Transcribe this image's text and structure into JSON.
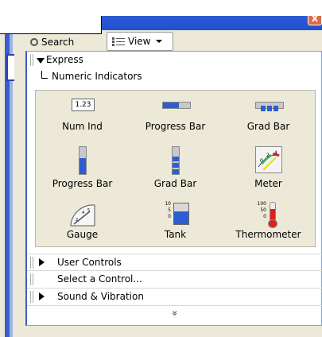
{
  "toolbar": {
    "search_label": "Search",
    "view_label": "View"
  },
  "titlebar": {
    "close_label": "x"
  },
  "tree": {
    "express_label": "Express",
    "numeric_indicators_label": "Numeric Indicators",
    "user_controls_label": "User Controls",
    "select_control_label": "Select a Control...",
    "sound_vibration_label": "Sound & Vibration",
    "more_label": "»"
  },
  "palette": {
    "items": [
      {
        "label": "Num Ind",
        "icon": "num-ind-icon",
        "value_text": "1.23"
      },
      {
        "label": "Progress Bar",
        "icon": "progress-bar-icon"
      },
      {
        "label": "Grad Bar",
        "icon": "grad-bar-icon"
      },
      {
        "label": "Progress Bar",
        "icon": "vertical-progress-bar-icon"
      },
      {
        "label": "Grad Bar",
        "icon": "vertical-grad-bar-icon"
      },
      {
        "label": "Meter",
        "icon": "meter-icon"
      },
      {
        "label": "Gauge",
        "icon": "gauge-icon"
      },
      {
        "label": "Tank",
        "icon": "tank-icon"
      },
      {
        "label": "Thermometer",
        "icon": "thermometer-icon"
      }
    ],
    "tank_ticks": [
      "10",
      "5",
      "0"
    ],
    "thermo_ticks": [
      "100",
      "50",
      "0"
    ],
    "meter_ticks": [
      "0",
      "2",
      "4"
    ]
  },
  "colors": {
    "accent": "#2b58d3",
    "bar_fill": "#2c5ed2",
    "thermo_red": "#d8221c"
  }
}
